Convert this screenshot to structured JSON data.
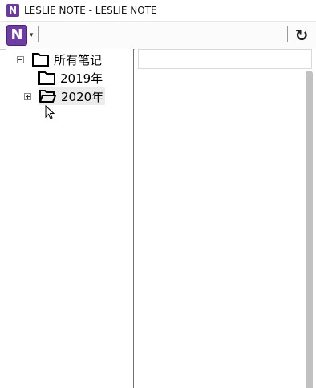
{
  "window": {
    "title": "LESLIE NOTE - LESLIE NOTE",
    "app_icon_letter": "N"
  },
  "toolbar": {
    "logo_letter": "N",
    "logo_caret": "▾",
    "refresh_icon": "refresh-icon",
    "refresh_glyph": "↻"
  },
  "tree": {
    "root": {
      "label": "所有笔记",
      "expanded": true
    },
    "children": [
      {
        "label": "2019年",
        "expanded": false,
        "has_children": false
      },
      {
        "label": "2020年",
        "expanded": false,
        "has_children": true,
        "selected": true
      }
    ]
  },
  "colors": {
    "brand": "#6f3ca6",
    "scrollbar": "#c1c1c1",
    "selection": "#ececec"
  }
}
